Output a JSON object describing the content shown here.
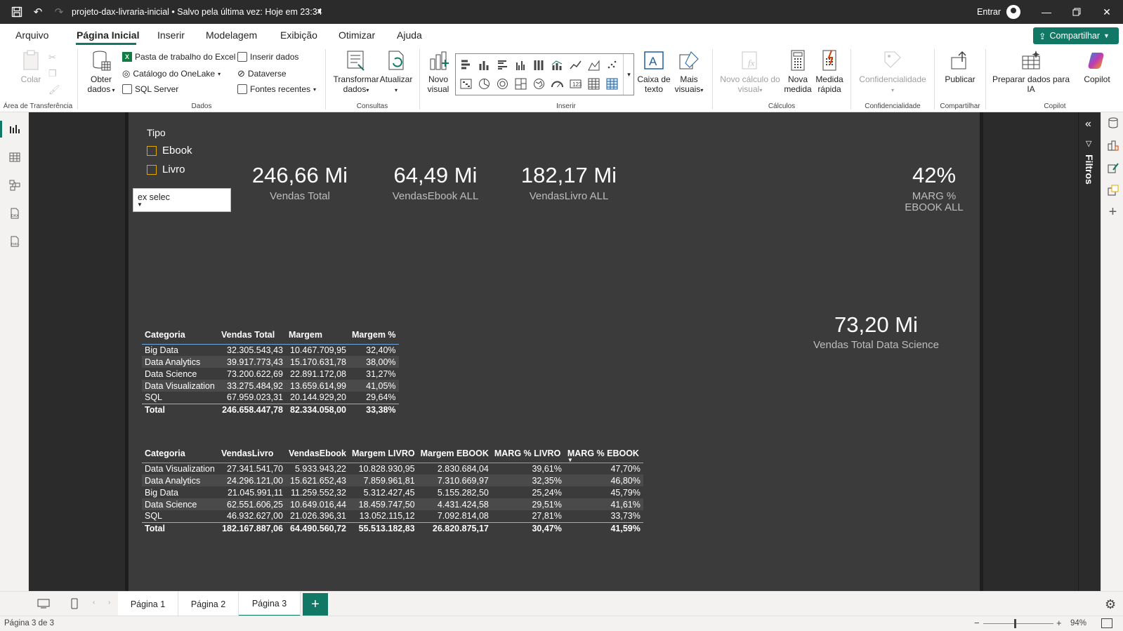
{
  "titlebar": {
    "title": "projeto-dax-livraria-inicial • Salvo pela última vez: Hoje em 23:34",
    "signin": "Entrar"
  },
  "menu": {
    "items": [
      "Arquivo",
      "Página Inicial",
      "Inserir",
      "Modelagem",
      "Exibição",
      "Otimizar",
      "Ajuda"
    ],
    "active": "Página Inicial",
    "share": "Compartilhar"
  },
  "ribbon": {
    "clipboard": {
      "paste": "Colar",
      "label": "Área de Transferência"
    },
    "data": {
      "get_data_1": "Obter",
      "get_data_2": "dados",
      "excel": "Pasta de trabalho do Excel",
      "onelake": "Catálogo do OneLake",
      "sql": "SQL Server",
      "enter_data": "Inserir dados",
      "dataverse": "Dataverse",
      "recent": "Fontes recentes",
      "label": "Dados"
    },
    "queries": {
      "transform_1": "Transformar",
      "transform_2": "dados",
      "refresh": "Atualizar",
      "label": "Consultas"
    },
    "insert": {
      "new_visual_1": "Novo",
      "new_visual_2": "visual",
      "textbox_1": "Caixa de",
      "textbox_2": "texto",
      "more_1": "Mais",
      "more_2": "visuais",
      "label": "Inserir"
    },
    "calc": {
      "new_calc_1": "Novo cálculo do",
      "new_calc_2": "visual",
      "new_measure_1": "Nova",
      "new_measure_2": "medida",
      "quick_1": "Medida",
      "quick_2": "rápida",
      "label": "Cálculos"
    },
    "sensitivity": {
      "btn": "Confidencialidade",
      "label": "Confidencialidade"
    },
    "share": {
      "publish": "Publicar",
      "label": "Compartilhar"
    },
    "copilot": {
      "prep_1": "Preparar dados para",
      "prep_2": "IA",
      "copilot": "Copilot",
      "label": "Copilot"
    }
  },
  "filters_label": "Filtros",
  "report": {
    "slicer": {
      "title": "Tipo",
      "items": [
        "Ebook",
        "Livro"
      ]
    },
    "dropdown_text": "ex selec",
    "kpis": [
      {
        "value": "246,66 Mi",
        "label": "Vendas Total"
      },
      {
        "value": "64,49 Mi",
        "label": "VendasEbook ALL"
      },
      {
        "value": "182,17 Mi",
        "label": "VendasLivro ALL"
      },
      {
        "value": "42%",
        "label_1": "MARG %",
        "label_2": "EBOOK ALL"
      },
      {
        "value": "73,20 Mi",
        "label": "Vendas Total Data Science"
      }
    ],
    "table1": {
      "headers": [
        "Categoria",
        "Vendas Total",
        "Margem",
        "Margem %"
      ],
      "rows": [
        [
          "Big Data",
          "32.305.543,43",
          "10.467.709,95",
          "32,40%"
        ],
        [
          "Data Analytics",
          "39.917.773,43",
          "15.170.631,78",
          "38,00%"
        ],
        [
          "Data Science",
          "73.200.622,69",
          "22.891.172,08",
          "31,27%"
        ],
        [
          "Data Visualization",
          "33.275.484,92",
          "13.659.614,99",
          "41,05%"
        ],
        [
          "SQL",
          "67.959.023,31",
          "20.144.929,20",
          "29,64%"
        ]
      ],
      "total": [
        "Total",
        "246.658.447,78",
        "82.334.058,00",
        "33,38%"
      ]
    },
    "table2": {
      "headers": [
        "Categoria",
        "VendasLivro",
        "VendasEbook",
        "Margem LIVRO",
        "Margem EBOOK",
        "MARG % LIVRO",
        "MARG % EBOOK"
      ],
      "rows": [
        [
          "Data Visualization",
          "27.341.541,70",
          "5.933.943,22",
          "10.828.930,95",
          "2.830.684,04",
          "39,61%",
          "47,70%"
        ],
        [
          "Data Analytics",
          "24.296.121,00",
          "15.621.652,43",
          "7.859.961,81",
          "7.310.669,97",
          "32,35%",
          "46,80%"
        ],
        [
          "Big Data",
          "21.045.991,11",
          "11.259.552,32",
          "5.312.427,45",
          "5.155.282,50",
          "25,24%",
          "45,79%"
        ],
        [
          "Data Science",
          "62.551.606,25",
          "10.649.016,44",
          "18.459.747,50",
          "4.431.424,58",
          "29,51%",
          "41,61%"
        ],
        [
          "SQL",
          "46.932.627,00",
          "21.026.396,31",
          "13.052.115,12",
          "7.092.814,08",
          "27,81%",
          "33,73%"
        ]
      ],
      "total": [
        "Total",
        "182.167.887,06",
        "64.490.560,72",
        "55.513.182,83",
        "26.820.875,17",
        "30,47%",
        "41,59%"
      ]
    }
  },
  "pages": {
    "tabs": [
      "Página 1",
      "Página 2",
      "Página 3"
    ],
    "active": "Página 3"
  },
  "status": {
    "page_info": "Página 3 de 3",
    "zoom": "94%"
  },
  "colors": {
    "accent": "#117865",
    "canvas": "#3b3b3b",
    "slicer_box": "#e0a800"
  }
}
